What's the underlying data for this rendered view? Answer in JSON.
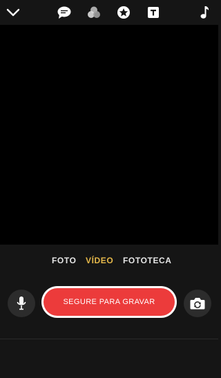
{
  "top_bar": {
    "icons": [
      "chevron-down-icon",
      "chat-bubble-icon",
      "filters-icon",
      "star-badge-icon",
      "text-icon",
      "music-note-icon"
    ],
    "text_icon_glyph": "T"
  },
  "modes": {
    "items": [
      {
        "label": "FOTO",
        "active": false
      },
      {
        "label": "VÍDEO",
        "active": true
      },
      {
        "label": "FOTOTECA",
        "active": false
      }
    ],
    "active_color": "#e5b84a"
  },
  "controls": {
    "record_label": "SEGURE PARA GRAVAR",
    "record_color": "#ec3b3b",
    "mic_icon": "microphone-icon",
    "switch_icon": "camera-switch-icon"
  }
}
